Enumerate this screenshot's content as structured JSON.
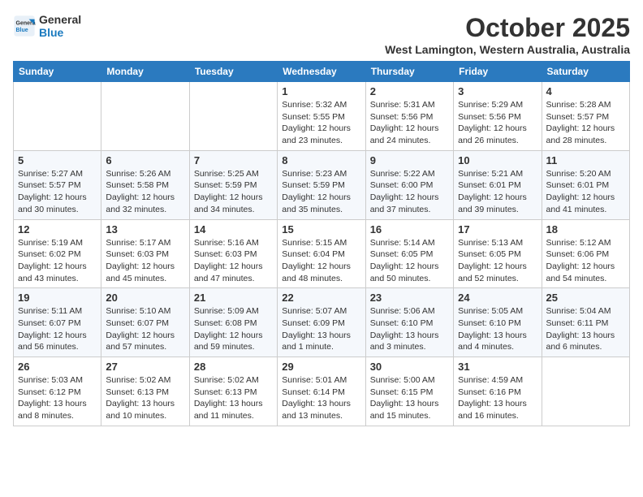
{
  "logo": {
    "line1": "General",
    "line2": "Blue"
  },
  "title": "October 2025",
  "location": "West Lamington, Western Australia, Australia",
  "days": [
    "Sunday",
    "Monday",
    "Tuesday",
    "Wednesday",
    "Thursday",
    "Friday",
    "Saturday"
  ],
  "weeks": [
    [
      {
        "date": "",
        "info": ""
      },
      {
        "date": "",
        "info": ""
      },
      {
        "date": "",
        "info": ""
      },
      {
        "date": "1",
        "info": "Sunrise: 5:32 AM\nSunset: 5:55 PM\nDaylight: 12 hours\nand 23 minutes."
      },
      {
        "date": "2",
        "info": "Sunrise: 5:31 AM\nSunset: 5:56 PM\nDaylight: 12 hours\nand 24 minutes."
      },
      {
        "date": "3",
        "info": "Sunrise: 5:29 AM\nSunset: 5:56 PM\nDaylight: 12 hours\nand 26 minutes."
      },
      {
        "date": "4",
        "info": "Sunrise: 5:28 AM\nSunset: 5:57 PM\nDaylight: 12 hours\nand 28 minutes."
      }
    ],
    [
      {
        "date": "5",
        "info": "Sunrise: 5:27 AM\nSunset: 5:57 PM\nDaylight: 12 hours\nand 30 minutes."
      },
      {
        "date": "6",
        "info": "Sunrise: 5:26 AM\nSunset: 5:58 PM\nDaylight: 12 hours\nand 32 minutes."
      },
      {
        "date": "7",
        "info": "Sunrise: 5:25 AM\nSunset: 5:59 PM\nDaylight: 12 hours\nand 34 minutes."
      },
      {
        "date": "8",
        "info": "Sunrise: 5:23 AM\nSunset: 5:59 PM\nDaylight: 12 hours\nand 35 minutes."
      },
      {
        "date": "9",
        "info": "Sunrise: 5:22 AM\nSunset: 6:00 PM\nDaylight: 12 hours\nand 37 minutes."
      },
      {
        "date": "10",
        "info": "Sunrise: 5:21 AM\nSunset: 6:01 PM\nDaylight: 12 hours\nand 39 minutes."
      },
      {
        "date": "11",
        "info": "Sunrise: 5:20 AM\nSunset: 6:01 PM\nDaylight: 12 hours\nand 41 minutes."
      }
    ],
    [
      {
        "date": "12",
        "info": "Sunrise: 5:19 AM\nSunset: 6:02 PM\nDaylight: 12 hours\nand 43 minutes."
      },
      {
        "date": "13",
        "info": "Sunrise: 5:17 AM\nSunset: 6:03 PM\nDaylight: 12 hours\nand 45 minutes."
      },
      {
        "date": "14",
        "info": "Sunrise: 5:16 AM\nSunset: 6:03 PM\nDaylight: 12 hours\nand 47 minutes."
      },
      {
        "date": "15",
        "info": "Sunrise: 5:15 AM\nSunset: 6:04 PM\nDaylight: 12 hours\nand 48 minutes."
      },
      {
        "date": "16",
        "info": "Sunrise: 5:14 AM\nSunset: 6:05 PM\nDaylight: 12 hours\nand 50 minutes."
      },
      {
        "date": "17",
        "info": "Sunrise: 5:13 AM\nSunset: 6:05 PM\nDaylight: 12 hours\nand 52 minutes."
      },
      {
        "date": "18",
        "info": "Sunrise: 5:12 AM\nSunset: 6:06 PM\nDaylight: 12 hours\nand 54 minutes."
      }
    ],
    [
      {
        "date": "19",
        "info": "Sunrise: 5:11 AM\nSunset: 6:07 PM\nDaylight: 12 hours\nand 56 minutes."
      },
      {
        "date": "20",
        "info": "Sunrise: 5:10 AM\nSunset: 6:07 PM\nDaylight: 12 hours\nand 57 minutes."
      },
      {
        "date": "21",
        "info": "Sunrise: 5:09 AM\nSunset: 6:08 PM\nDaylight: 12 hours\nand 59 minutes."
      },
      {
        "date": "22",
        "info": "Sunrise: 5:07 AM\nSunset: 6:09 PM\nDaylight: 13 hours\nand 1 minute."
      },
      {
        "date": "23",
        "info": "Sunrise: 5:06 AM\nSunset: 6:10 PM\nDaylight: 13 hours\nand 3 minutes."
      },
      {
        "date": "24",
        "info": "Sunrise: 5:05 AM\nSunset: 6:10 PM\nDaylight: 13 hours\nand 4 minutes."
      },
      {
        "date": "25",
        "info": "Sunrise: 5:04 AM\nSunset: 6:11 PM\nDaylight: 13 hours\nand 6 minutes."
      }
    ],
    [
      {
        "date": "26",
        "info": "Sunrise: 5:03 AM\nSunset: 6:12 PM\nDaylight: 13 hours\nand 8 minutes."
      },
      {
        "date": "27",
        "info": "Sunrise: 5:02 AM\nSunset: 6:13 PM\nDaylight: 13 hours\nand 10 minutes."
      },
      {
        "date": "28",
        "info": "Sunrise: 5:02 AM\nSunset: 6:13 PM\nDaylight: 13 hours\nand 11 minutes."
      },
      {
        "date": "29",
        "info": "Sunrise: 5:01 AM\nSunset: 6:14 PM\nDaylight: 13 hours\nand 13 minutes."
      },
      {
        "date": "30",
        "info": "Sunrise: 5:00 AM\nSunset: 6:15 PM\nDaylight: 13 hours\nand 15 minutes."
      },
      {
        "date": "31",
        "info": "Sunrise: 4:59 AM\nSunset: 6:16 PM\nDaylight: 13 hours\nand 16 minutes."
      },
      {
        "date": "",
        "info": ""
      }
    ]
  ]
}
